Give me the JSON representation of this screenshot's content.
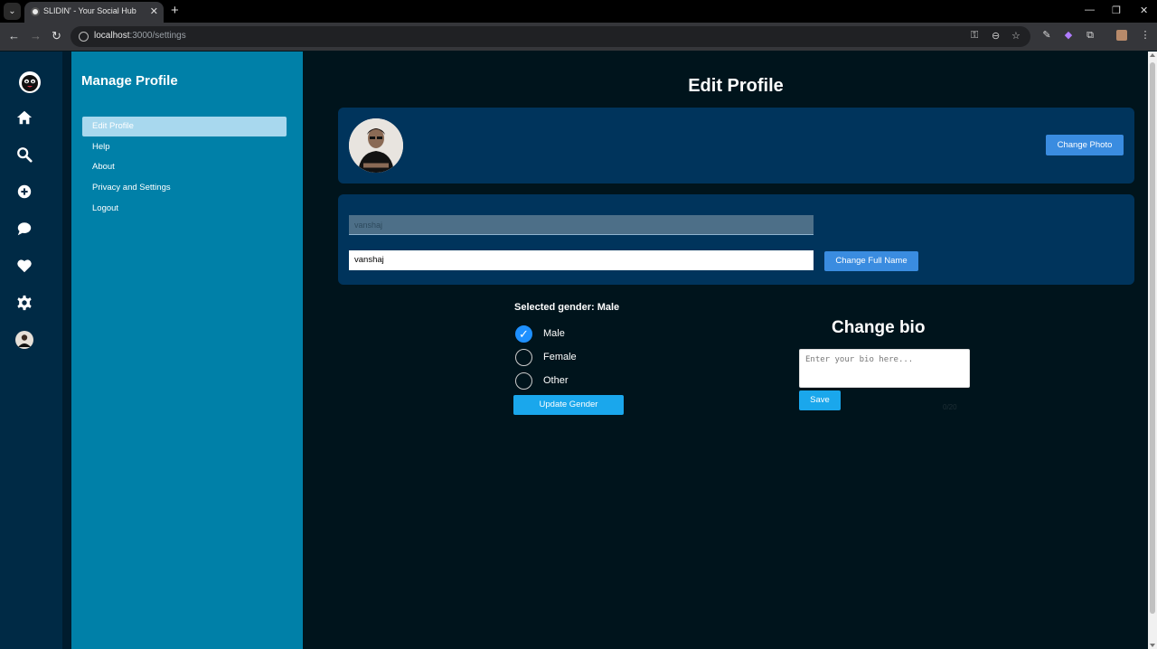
{
  "browser": {
    "tab_title": "SLIDIN' - Your Social Hub",
    "url_host": "localhost",
    "url_path": ":3000/settings"
  },
  "rail": {
    "icons": [
      "logo-icon",
      "home-icon",
      "search-icon",
      "add-icon",
      "chat-icon",
      "heart-icon",
      "gear-icon",
      "profile-avatar"
    ]
  },
  "menu": {
    "title": "Manage Profile",
    "items": [
      {
        "label": "Edit Profile",
        "active": true
      },
      {
        "label": "Help"
      },
      {
        "label": "About"
      },
      {
        "label": "Privacy and Settings"
      },
      {
        "label": "Logout"
      }
    ]
  },
  "edit": {
    "title": "Edit Profile",
    "change_photo": "Change Photo",
    "username_placeholder": "vanshaj",
    "fullname_value": "vanshaj",
    "change_fullname": "Change Full Name"
  },
  "gender": {
    "selected_text": "Selected gender: Male",
    "options": [
      {
        "label": "Male",
        "checked": true
      },
      {
        "label": "Female"
      },
      {
        "label": "Other"
      }
    ],
    "update_button": "Update Gender"
  },
  "bio": {
    "title": "Change bio",
    "placeholder": "Enter your bio here...",
    "save_button": "Save",
    "faint_text": "0/20"
  },
  "colors": {
    "rail": "#002a45",
    "menu_panel": "#0080a8",
    "menu_active": "#a8d8ee",
    "main_bg": "#00141c",
    "card_bg": "#00345c",
    "button_blue": "#3a8ce0",
    "button_cyan": "#1aa7ec"
  }
}
